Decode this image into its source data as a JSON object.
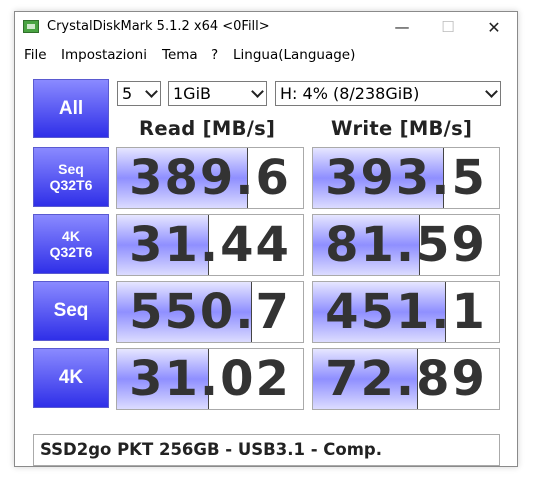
{
  "window": {
    "title": "CrystalDiskMark 5.1.2 x64 <0Fill>",
    "min_label": "—",
    "max_label": "☐",
    "close_label": "✕"
  },
  "menu": {
    "items": [
      "File",
      "Impostazioni",
      "Tema",
      "?",
      "Lingua(Language)"
    ]
  },
  "controls": {
    "all_label": "All",
    "runs": "5",
    "size": "1GiB",
    "drive": "H: 4% (8/238GiB)"
  },
  "headers": {
    "read": "Read [MB/s]",
    "write": "Write [MB/s]"
  },
  "rows": [
    {
      "label1": "Seq",
      "label2": "Q32T6",
      "read": "389.6",
      "write": "393.5",
      "read_fill": 0.7,
      "write_fill": 0.7
    },
    {
      "label1": "4K",
      "label2": "Q32T6",
      "read": "31.44",
      "write": "81.59",
      "read_fill": 0.49,
      "write_fill": 0.57
    },
    {
      "label1": "Seq",
      "label2": "",
      "read": "550.7",
      "write": "451.1",
      "read_fill": 0.72,
      "write_fill": 0.71
    },
    {
      "label1": "4K",
      "label2": "",
      "read": "31.02",
      "write": "72.89",
      "read_fill": 0.49,
      "write_fill": 0.56
    }
  ],
  "comment": "SSD2go PKT 256GB - USB3.1 - Comp.",
  "colors": {
    "button_top": "#8a8aff",
    "button_bottom": "#2f2fe8",
    "bar_mid": "#8f8fff"
  }
}
